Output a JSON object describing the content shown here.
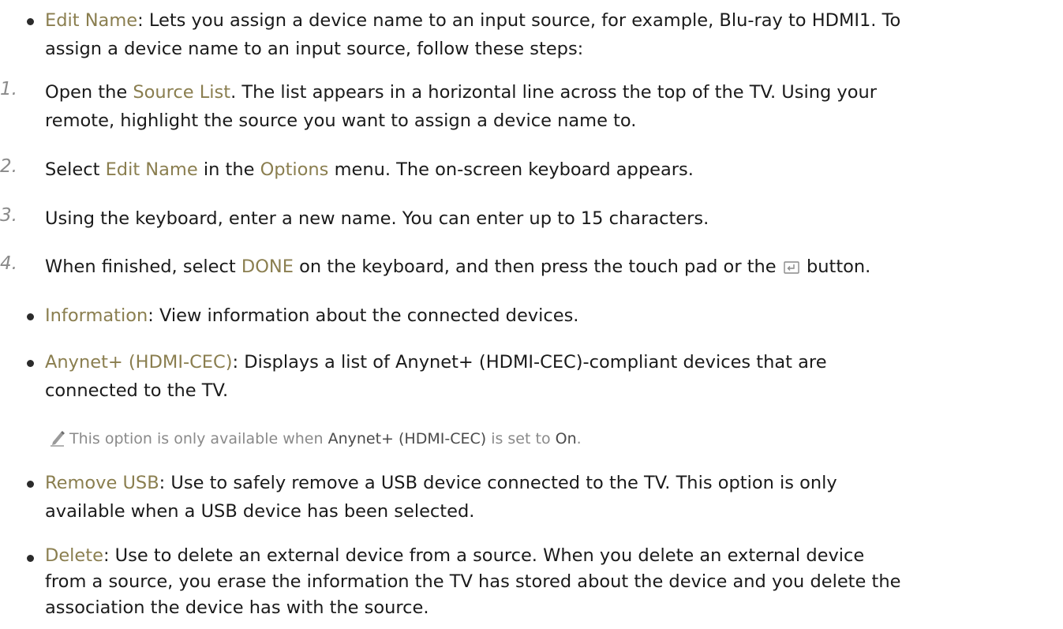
{
  "edit_name": {
    "term": "Edit Name",
    "sep": ": ",
    "line1": "Lets you assign a device name to an input source, for example, Blu-ray to HDMI1. To",
    "line2": "assign a device name to an input source, follow these steps:"
  },
  "steps": [
    {
      "num": "1.",
      "a": "Open the ",
      "kw1": "Source List",
      "b": ". The list appears in a horizontal line across the top of the TV. Using your",
      "line2": "remote, highlight the source you want to assign a device name to."
    },
    {
      "num": "2.",
      "a": "Select ",
      "kw1": "Edit Name",
      "b": " in the ",
      "kw2": "Options",
      "c": " menu. The on-screen keyboard appears."
    },
    {
      "num": "3.",
      "a": "Using the keyboard, enter a new name. You can enter up to 15 characters."
    },
    {
      "num": "4.",
      "a": "When finished, select ",
      "kw1": "DONE",
      "b": " on the keyboard, and then press the touch pad or the ",
      "c": " button.",
      "icon": "enter-button-icon"
    }
  ],
  "information": {
    "term": "Information",
    "sep": ": ",
    "text": "View information about the connected devices."
  },
  "anynet": {
    "term": "Anynet+ (HDMI-CEC)",
    "sep": ": ",
    "line1": "Displays a list of Anynet+ (HDMI-CEC)-compliant devices that are",
    "line2": "connected to the TV."
  },
  "note": {
    "icon": "pencil-icon",
    "a": "This option is only available when ",
    "kw1": "Anynet+ (HDMI-CEC)",
    "b": " is set to ",
    "kw2": "On",
    "c": "."
  },
  "remove_usb": {
    "term": "Remove USB",
    "sep": ": ",
    "line1": "Use to safely remove a USB device connected to the TV. This option is only",
    "line2": "available when a USB device has been selected."
  },
  "delete": {
    "term": "Delete",
    "sep": ": ",
    "line1": "Use to delete an external device from a source. When you delete an external device",
    "line2": "from a source, you erase the information the TV has stored about the device and you delete the",
    "line3": "association the device has with the source."
  },
  "colors": {
    "keyword": "#8a7e4f",
    "step_number": "#8a8a8a",
    "note_text": "#8a8a8a"
  }
}
